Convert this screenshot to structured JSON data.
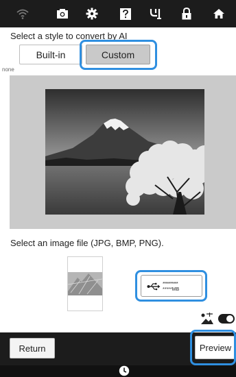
{
  "topbar": {
    "icons": [
      "wifi-icon",
      "camera-icon",
      "settings-gear-icon",
      "help-icon",
      "embroidery-machine-icon",
      "lock-icon",
      "home-icon"
    ]
  },
  "style_section": {
    "label": "Select a style to convert by AI",
    "tabs": [
      {
        "label": "Built-in",
        "selected": false
      },
      {
        "label": "Custom",
        "selected": true
      }
    ],
    "style_name": "none"
  },
  "file_section": {
    "label": "Select an image file (JPG, BMP, PNG).",
    "usb_capacity_dots": "**********",
    "usb_capacity_unit": "*****MB"
  },
  "bottom": {
    "return_label": "Return",
    "preview_label": "Preview"
  },
  "colors": {
    "highlight": "#2f8fe0",
    "bar_background": "#1c1c1c",
    "preview_background": "#cacaca"
  }
}
